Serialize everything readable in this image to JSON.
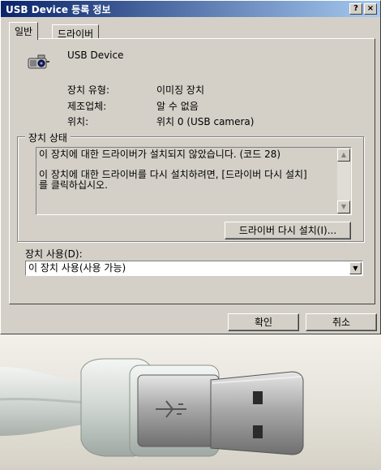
{
  "window": {
    "title": "USB Device 등록 정보",
    "help_btn": "?",
    "close_btn": "×"
  },
  "tabs": [
    {
      "label": "일반",
      "active": true
    },
    {
      "label": "드라이버",
      "active": false
    }
  ],
  "device": {
    "icon": "camera-device-icon",
    "name": "USB Device"
  },
  "properties": [
    {
      "label": "장치 유형:",
      "value": "이미징 장치"
    },
    {
      "label": "제조업체:",
      "value": "알 수 없음"
    },
    {
      "label": "위치:",
      "value": "위치 0 (USB camera)"
    }
  ],
  "status": {
    "group_label": "장치 상태",
    "line1": "이 장치에 대한 드라이버가 설치되지 않았습니다. (코드 28)",
    "line2": "이 장치에 대한 드라이버를 다시 설치하려면, [드라이버 다시 설치]",
    "line3": "를 클릭하십시오.",
    "reinstall_button": "드라이버 다시 설치(I)..."
  },
  "usage": {
    "label": "장치 사용(D):",
    "selected": "이 장치 사용(사용 가능)"
  },
  "buttons": {
    "ok": "확인",
    "cancel": "취소"
  },
  "colors": {
    "dialog_bg": "#d4d0c8",
    "titlebar_start": "#0a246a",
    "titlebar_end": "#a6caf0"
  }
}
